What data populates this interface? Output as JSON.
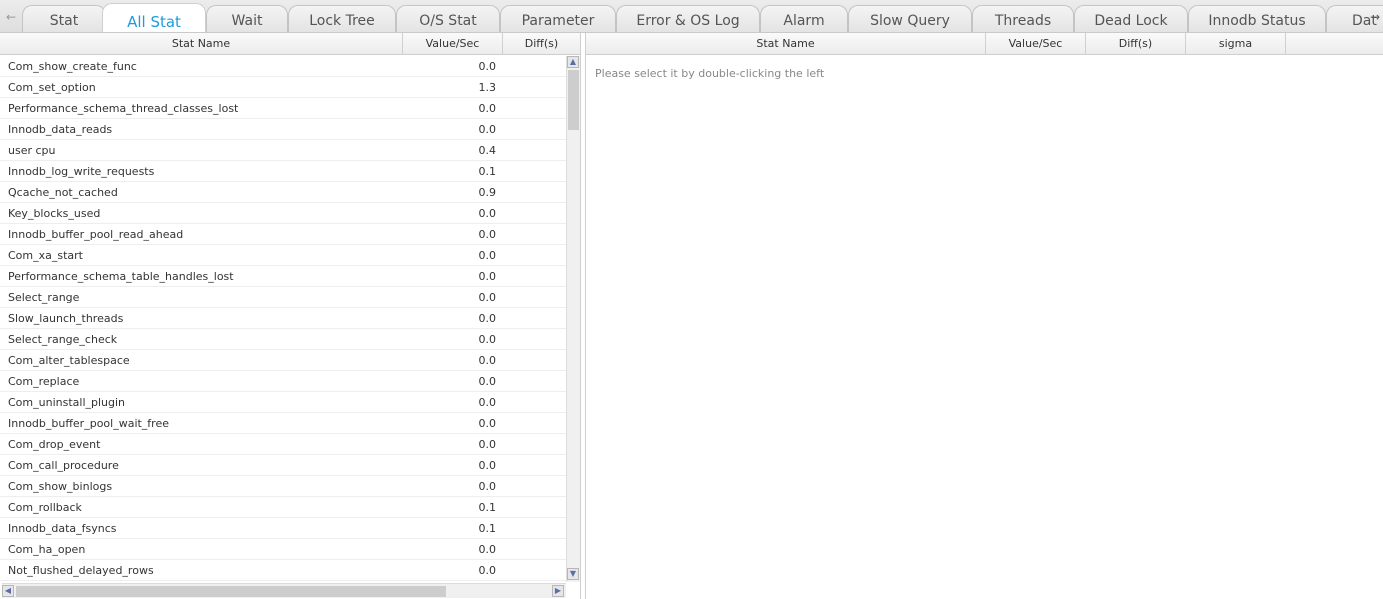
{
  "tabs": [
    {
      "label": "Stat",
      "active": false
    },
    {
      "label": "All Stat",
      "active": true
    },
    {
      "label": "Wait",
      "active": false
    },
    {
      "label": "Lock Tree",
      "active": false
    },
    {
      "label": "O/S Stat",
      "active": false
    },
    {
      "label": "Parameter",
      "active": false
    },
    {
      "label": "Error & OS Log",
      "active": false
    },
    {
      "label": "Alarm",
      "active": false
    },
    {
      "label": "Slow Query",
      "active": false
    },
    {
      "label": "Threads",
      "active": false
    },
    {
      "label": "Dead Lock",
      "active": false
    },
    {
      "label": "Innodb Status",
      "active": false
    },
    {
      "label": "Dat",
      "active": false
    }
  ],
  "tab_scroll": {
    "left_icon": "arrow-left-icon",
    "right_icon": "arrow-right-icon",
    "left_glyph": "←",
    "right_glyph": "→"
  },
  "left_grid": {
    "columns": [
      "Stat Name",
      "Value/Sec",
      "Diff(s)"
    ],
    "rows": [
      {
        "name": "Com_show_create_func",
        "value": "0.0",
        "diff": ""
      },
      {
        "name": "Com_set_option",
        "value": "1.3",
        "diff": ""
      },
      {
        "name": "Performance_schema_thread_classes_lost",
        "value": "0.0",
        "diff": ""
      },
      {
        "name": "Innodb_data_reads",
        "value": "0.0",
        "diff": ""
      },
      {
        "name": "user cpu",
        "value": "0.4",
        "diff": ""
      },
      {
        "name": "Innodb_log_write_requests",
        "value": "0.1",
        "diff": ""
      },
      {
        "name": "Qcache_not_cached",
        "value": "0.9",
        "diff": ""
      },
      {
        "name": "Key_blocks_used",
        "value": "0.0",
        "diff": ""
      },
      {
        "name": "Innodb_buffer_pool_read_ahead",
        "value": "0.0",
        "diff": ""
      },
      {
        "name": "Com_xa_start",
        "value": "0.0",
        "diff": ""
      },
      {
        "name": "Performance_schema_table_handles_lost",
        "value": "0.0",
        "diff": ""
      },
      {
        "name": "Select_range",
        "value": "0.0",
        "diff": ""
      },
      {
        "name": "Slow_launch_threads",
        "value": "0.0",
        "diff": ""
      },
      {
        "name": "Select_range_check",
        "value": "0.0",
        "diff": ""
      },
      {
        "name": "Com_alter_tablespace",
        "value": "0.0",
        "diff": ""
      },
      {
        "name": "Com_replace",
        "value": "0.0",
        "diff": ""
      },
      {
        "name": "Com_uninstall_plugin",
        "value": "0.0",
        "diff": ""
      },
      {
        "name": "Innodb_buffer_pool_wait_free",
        "value": "0.0",
        "diff": ""
      },
      {
        "name": "Com_drop_event",
        "value": "0.0",
        "diff": ""
      },
      {
        "name": "Com_call_procedure",
        "value": "0.0",
        "diff": ""
      },
      {
        "name": "Com_show_binlogs",
        "value": "0.0",
        "diff": ""
      },
      {
        "name": "Com_rollback",
        "value": "0.1",
        "diff": ""
      },
      {
        "name": "Innodb_data_fsyncs",
        "value": "0.1",
        "diff": ""
      },
      {
        "name": "Com_ha_open",
        "value": "0.0",
        "diff": ""
      },
      {
        "name": "Not_flushed_delayed_rows",
        "value": "0.0",
        "diff": ""
      }
    ]
  },
  "right_grid": {
    "columns": [
      "Stat Name",
      "Value/Sec",
      "Diff(s)",
      "sigma"
    ],
    "placeholder": "Please select it by double-clicking the left"
  },
  "scrollbar_glyphs": {
    "up": "▲",
    "down": "▼",
    "left": "◀",
    "right": "▶"
  },
  "colors": {
    "active_tab": "#1e9be0"
  }
}
